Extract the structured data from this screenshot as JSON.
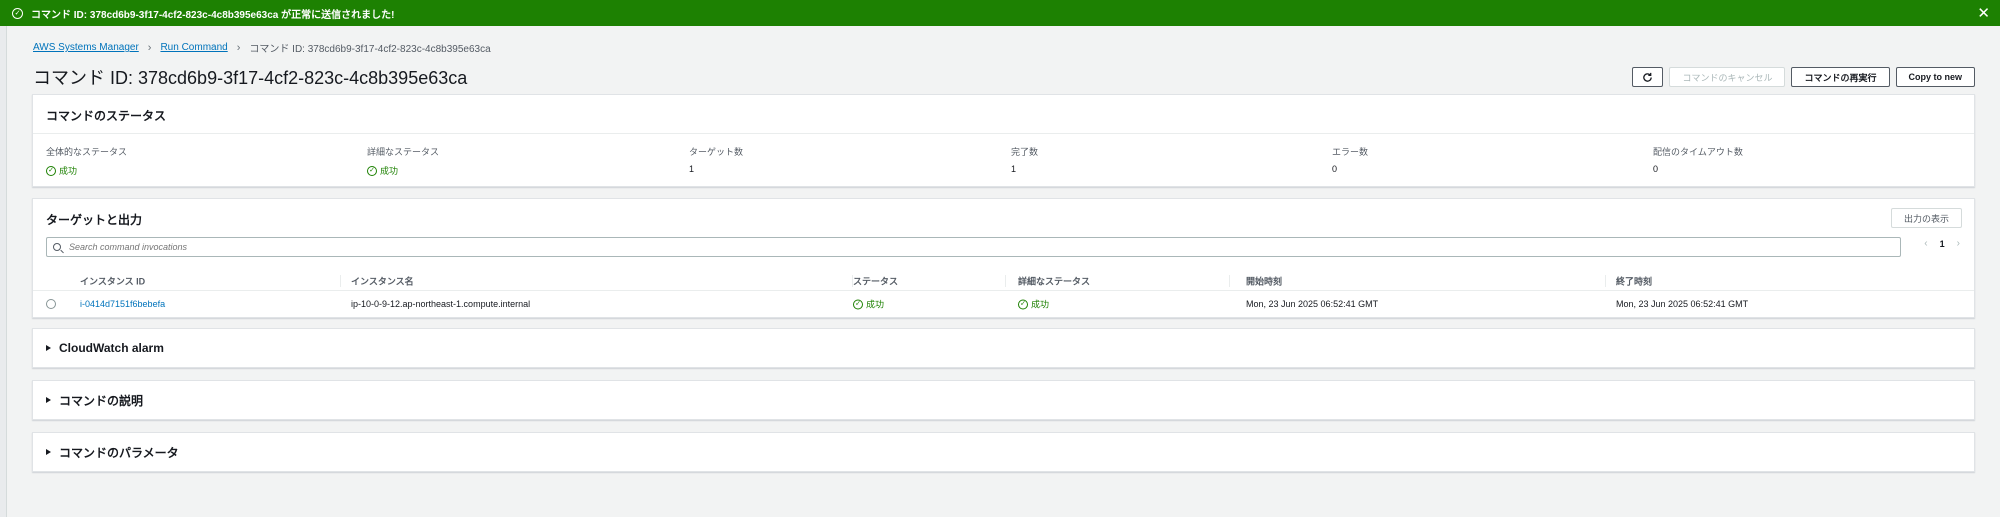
{
  "flash": {
    "message": "コマンド ID: 378cd6b9-3f17-4cf2-823c-4c8b395e63ca が正常に送信されました!",
    "close_icon": "close-icon",
    "color": "#1d8102"
  },
  "breadcrumb": {
    "items": [
      "AWS Systems Manager",
      "Run Command",
      "コマンド ID: 378cd6b9-3f17-4cf2-823c-4c8b395e63ca"
    ]
  },
  "page": {
    "title": "コマンド ID: 378cd6b9-3f17-4cf2-823c-4c8b395e63ca"
  },
  "actions": {
    "refresh_icon": "refresh-icon",
    "cancel_label": "コマンドのキャンセル",
    "rerun_label": "コマンドの再実行",
    "copy_label": "Copy to new"
  },
  "status": {
    "header": "コマンドのステータス",
    "items": [
      {
        "label": "全体的なステータス",
        "value": "成功"
      },
      {
        "label": "詳細なステータス",
        "value": "成功"
      },
      {
        "label": "ターゲット数",
        "value": "1"
      },
      {
        "label": "完了数",
        "value": "1"
      },
      {
        "label": "エラー数",
        "value": "0"
      },
      {
        "label": "配信のタイムアウト数",
        "value": "0"
      }
    ]
  },
  "targets": {
    "header": "ターゲットと出力",
    "output_button": "出力の表示",
    "search_placeholder": "Search command invocations",
    "page_number": "1",
    "columns": [
      "インスタンス ID",
      "インスタンス名",
      "ステータス",
      "詳細なステータス",
      "開始時刻",
      "終了時刻"
    ],
    "rows": [
      {
        "instance_id": "i-0414d7151f6bebefa",
        "instance_name": "ip-10-0-9-12.ap-northeast-1.compute.internal",
        "status": "成功",
        "detailed_status": "成功",
        "start_time": "Mon, 23 Jun 2025 06:52:41 GMT",
        "end_time": "Mon, 23 Jun 2025 06:52:41 GMT"
      }
    ]
  },
  "sections": {
    "cloudwatch": "CloudWatch alarm",
    "description": "コマンドの説明",
    "parameters": "コマンドのパラメータ"
  }
}
